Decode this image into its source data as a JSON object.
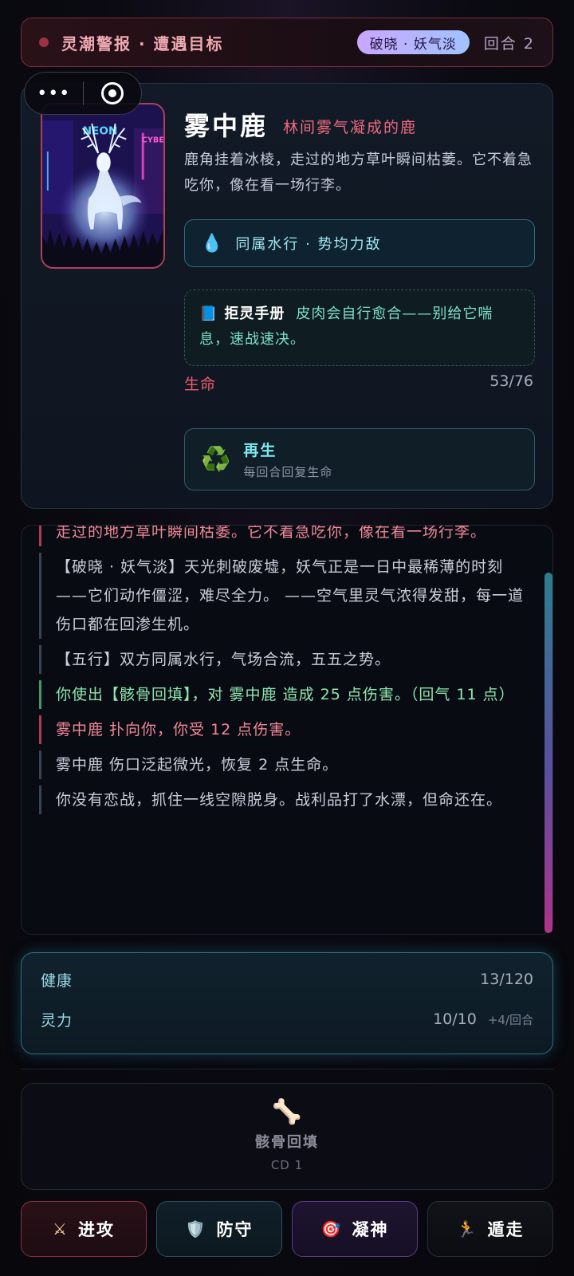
{
  "alert": {
    "title": "灵潮警报 · 遭遇目标",
    "phase": "破晓 · 妖气淡",
    "round": "回合 2"
  },
  "capsule": {
    "more_icon": "more-dots-icon",
    "more_glyph": "•••",
    "target_icon": "target-icon"
  },
  "enemy": {
    "name": "雾中鹿",
    "subtitle": "林间雾气凝成的鹿",
    "description": "鹿角挂着冰棱，走过的地方草叶瞬间枯萎。它不着急吃你，像在看一场行李。",
    "portrait_text_left": "NEON",
    "portrait_text_right": "CYBE",
    "element": {
      "icon": "water-drop-icon",
      "glyph": "💧",
      "text": "同属水行 · 势均力敌"
    },
    "manual": {
      "icon": "book-icon",
      "glyph": "📘",
      "title": "拒灵手册",
      "text": "皮肉会自行愈合——别给它喘息，速战速决。"
    },
    "hp_label": "生命",
    "hp_value": "53/76",
    "trait": {
      "icon": "recycle-icon",
      "glyph": "♻️",
      "title": "再生",
      "subtitle": "每回合回复生命"
    }
  },
  "log": [
    {
      "type": "enemy",
      "text": "走过的地方草叶瞬间枯萎。它不着急吃你，像在看一场行李。"
    },
    {
      "type": "system",
      "text": "【破晓 · 妖气淡】天光刺破废墟，妖气正是一日中最稀薄的时刻——它们动作僵涩，难尽全力。 ——空气里灵气浓得发甜，每一道伤口都在回渗生机。"
    },
    {
      "type": "system",
      "text": "【五行】双方同属水行，气场合流，五五之势。"
    },
    {
      "type": "player",
      "text": "你使出【骸骨回填】，对 雾中鹿 造成 25 点伤害。（回气 11 点）"
    },
    {
      "type": "enemy",
      "text": "雾中鹿 扑向你，你受 12 点伤害。"
    },
    {
      "type": "system",
      "text": "雾中鹿 伤口泛起微光，恢复 2 点生命。"
    },
    {
      "type": "system",
      "text": "你没有恋战，抓住一线空隙脱身。战利品打了水漂，但命还在。"
    }
  ],
  "player": {
    "health_label": "健康",
    "health_value": "13/120",
    "spirit_label": "灵力",
    "spirit_value": "10/10",
    "spirit_regen": "+4/回合"
  },
  "skill": {
    "icon": "bone-icon",
    "glyph": "🦴",
    "name": "骸骨回填",
    "cd": "CD 1"
  },
  "actions": [
    {
      "key": "attack",
      "icon": "swords-icon",
      "glyph": "⚔",
      "label": "进攻"
    },
    {
      "key": "defend",
      "icon": "shield-icon",
      "glyph": "🛡️",
      "label": "防守"
    },
    {
      "key": "focus",
      "icon": "target-dart-icon",
      "glyph": "🎯",
      "label": "凝神"
    },
    {
      "key": "flee",
      "icon": "running-icon",
      "glyph": "🏃",
      "label": "遁走"
    }
  ],
  "colors": {
    "enemy_accent": "#f06a7e",
    "player_accent": "#8ee6b0",
    "water_accent": "#4fb6e8",
    "scroll_gradient": [
      "#2e7d8e",
      "#5a4f9e",
      "#b0338a"
    ]
  }
}
